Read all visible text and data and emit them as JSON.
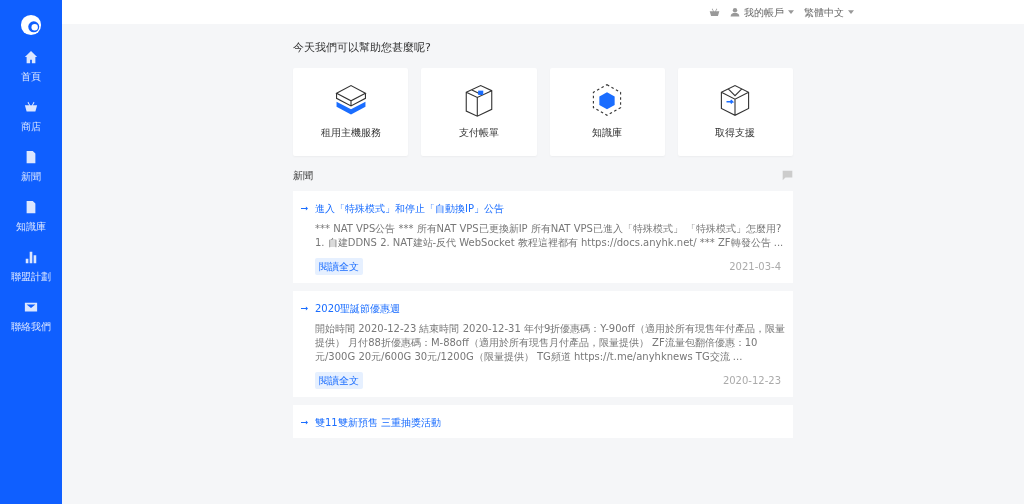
{
  "sidebar": {
    "items": [
      {
        "label": "首頁"
      },
      {
        "label": "商店"
      },
      {
        "label": "新聞"
      },
      {
        "label": "知識庫"
      },
      {
        "label": "聯盟計劃"
      },
      {
        "label": "聯絡我們"
      }
    ]
  },
  "topbar": {
    "account": "我的帳戶",
    "language": "繁體中文"
  },
  "heading": "今天我們可以幫助您甚麼呢?",
  "actions": [
    {
      "label": "租用主機服務"
    },
    {
      "label": "支付帳單"
    },
    {
      "label": "知識庫"
    },
    {
      "label": "取得支援"
    }
  ],
  "news": {
    "title": "新聞",
    "items": [
      {
        "title": "進入「特殊模式」和停止「自動換IP」公告",
        "body": "*** NAT VPS公告 ***   所有NAT VPS已更換新IP 所有NAT VPS已進入「特殊模式」   「特殊模式」怎麼用?  1. 自建DDNS 2. NAT建站-反代 WebSocket 教程這裡都有 https://docs.anyhk.net/   *** ZF轉發公告 ...",
        "button": "閱讀全文",
        "date": "2021-03-4"
      },
      {
        "title": "2020聖誕節優惠週",
        "body": "開始時間 2020-12-23 結束時間 2020-12-31   年付9折優惠碼：Y-90off（適用於所有現售年付產品，限量提供） 月付88折優惠碼：M-88off（適用於所有現售月付產品，限量提供） ZF流量包翻倍優惠：10元/300G 20元/600G 30元/1200G（限量提供）   TG頻道 https://t.me/anyhknews TG交流 ...",
        "button": "閱讀全文",
        "date": "2020-12-23"
      },
      {
        "title": "雙11雙新預售 三重抽獎活動"
      }
    ]
  }
}
